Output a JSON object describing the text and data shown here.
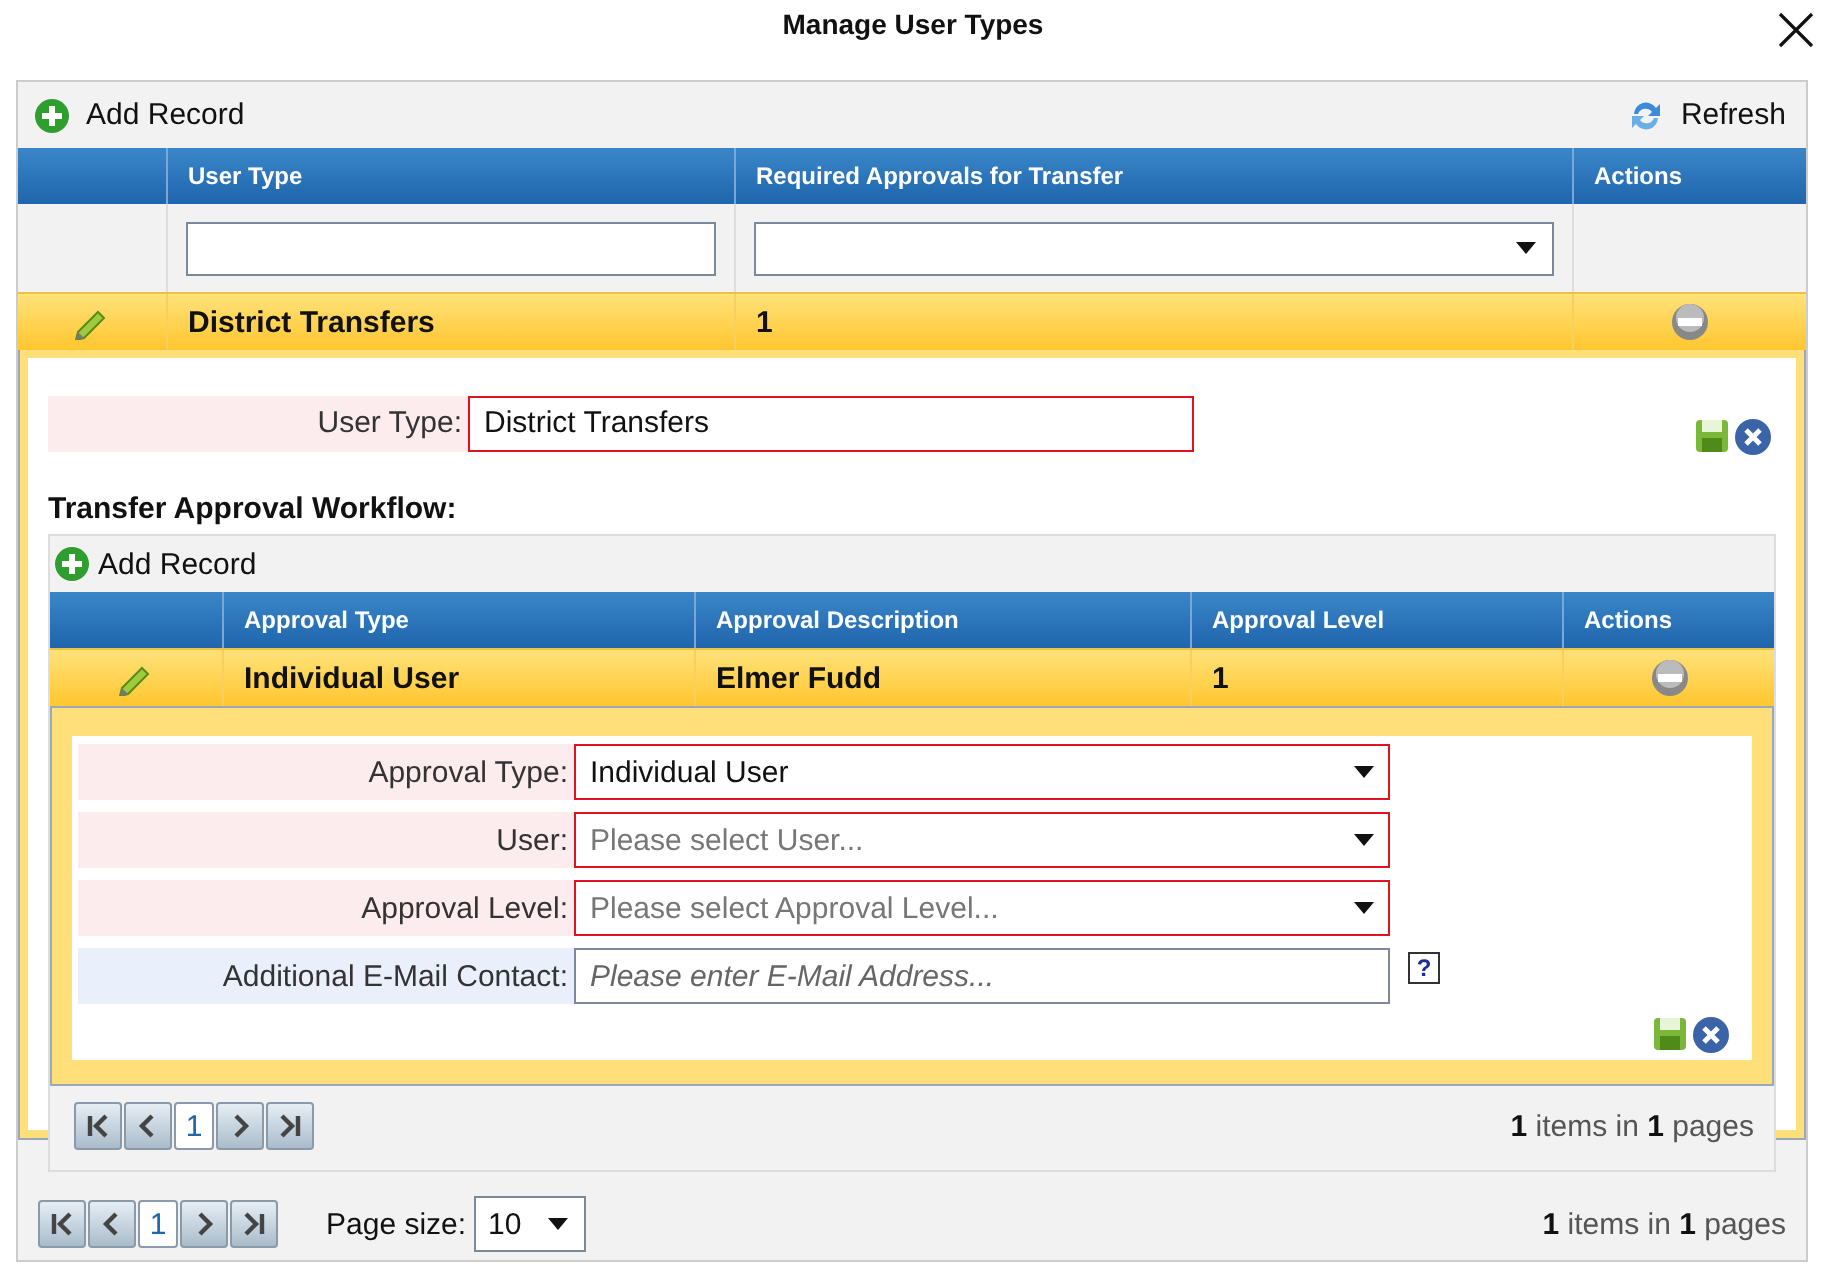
{
  "dialog": {
    "title": "Manage User Types"
  },
  "grid": {
    "add_label": "Add Record",
    "refresh_label": "Refresh",
    "columns": [
      "User Type",
      "Required Approvals for Transfer",
      "Actions"
    ],
    "rows": [
      {
        "user_type": "District Transfers",
        "required_approvals": "1",
        "expanded": true
      }
    ],
    "editor": {
      "label": "User Type:",
      "value": "District Transfers",
      "required": true
    },
    "workflow": {
      "title": "Transfer Approval Workflow:",
      "add_label": "Add Record",
      "columns": [
        "Approval Type",
        "Approval Description",
        "Approval Level",
        "Actions"
      ],
      "rows": [
        {
          "approval_type": "Individual User",
          "description": "Elmer Fudd",
          "level": "1",
          "expanded": true
        }
      ],
      "fields": [
        {
          "label": "Approval Type:",
          "kind": "select",
          "value": "Individual User",
          "required": true
        },
        {
          "label": "User:",
          "kind": "select",
          "placeholder": "Please select User...",
          "required": true
        },
        {
          "label": "Approval Level:",
          "kind": "select",
          "placeholder": "Please select Approval Level...",
          "required": true
        },
        {
          "label": "Additional E-Mail Contact:",
          "kind": "text",
          "placeholder": "Please enter E-Mail Address...",
          "required": false,
          "help": "?"
        }
      ],
      "pager": {
        "page": "1",
        "summary": "**1** items in **1** pages"
      }
    },
    "pager": {
      "page": "1",
      "page_size_label": "Page size:",
      "page_size": "10",
      "summary": "**1** items in **1** pages"
    }
  }
}
